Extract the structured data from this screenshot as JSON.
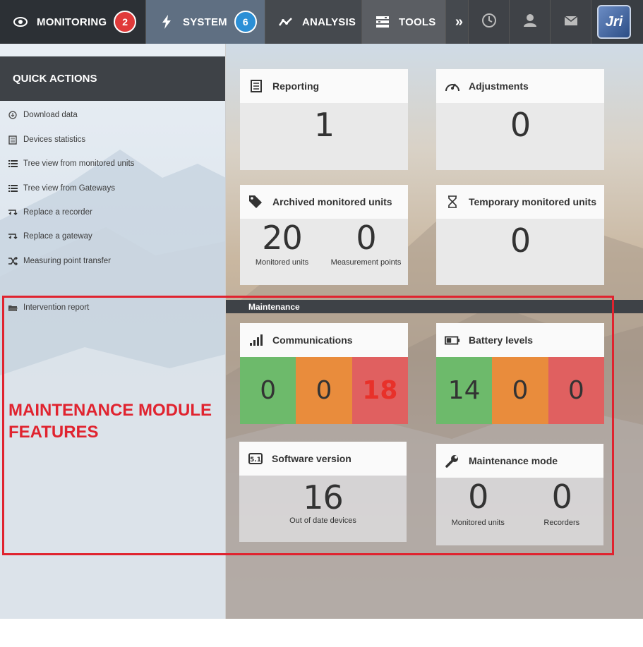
{
  "nav": {
    "monitoring": {
      "label": "MONITORING",
      "badge": "2"
    },
    "system": {
      "label": "SYSTEM",
      "badge": "6"
    },
    "analysis": {
      "label": "ANALYSIS"
    },
    "tools": {
      "label": "TOOLS"
    },
    "logo_text": "Jri"
  },
  "quick_actions": {
    "title": "QUICK ACTIONS",
    "items": [
      {
        "label": "Download data",
        "icon": "download-icon"
      },
      {
        "label": "Devices statistics",
        "icon": "document-list-icon"
      },
      {
        "label": "Tree view from monitored units",
        "icon": "tree-list-icon"
      },
      {
        "label": "Tree view from Gateways",
        "icon": "tree-list-icon"
      },
      {
        "label": "Replace a recorder",
        "icon": "replace-icon"
      },
      {
        "label": "Replace a gateway",
        "icon": "replace-icon"
      },
      {
        "label": "Measuring point transfer",
        "icon": "shuffle-icon"
      },
      {
        "label": "Intervention report",
        "icon": "folder-icon"
      }
    ]
  },
  "cards": {
    "reporting": {
      "title": "Reporting",
      "value": "1"
    },
    "adjustments": {
      "title": "Adjustments",
      "value": "0"
    },
    "archived": {
      "title": "Archived monitored units",
      "units_value": "20",
      "units_label": "Monitored units",
      "points_value": "0",
      "points_label": "Measurement points"
    },
    "temporary": {
      "title": "Temporary monitored units",
      "value": "0"
    },
    "communications": {
      "title": "Communications",
      "green": "0",
      "orange": "0",
      "red": "18"
    },
    "battery": {
      "title": "Battery levels",
      "green": "14",
      "orange": "0",
      "red": "0"
    },
    "software": {
      "title": "Software version",
      "value": "16",
      "label": "Out of date devices"
    },
    "maintenance_mode": {
      "title": "Maintenance mode",
      "units_value": "0",
      "units_label": "Monitored units",
      "recorders_value": "0",
      "recorders_label": "Recorders"
    }
  },
  "maintenance_section": {
    "label": "Maintenance"
  },
  "annotation": {
    "text": "MAINTENANCE MODULE FEATURES"
  },
  "colors": {
    "green": "#6dba6b",
    "orange": "#e98c3c",
    "red": "#e06060",
    "annotation_red": "#e0232f"
  }
}
